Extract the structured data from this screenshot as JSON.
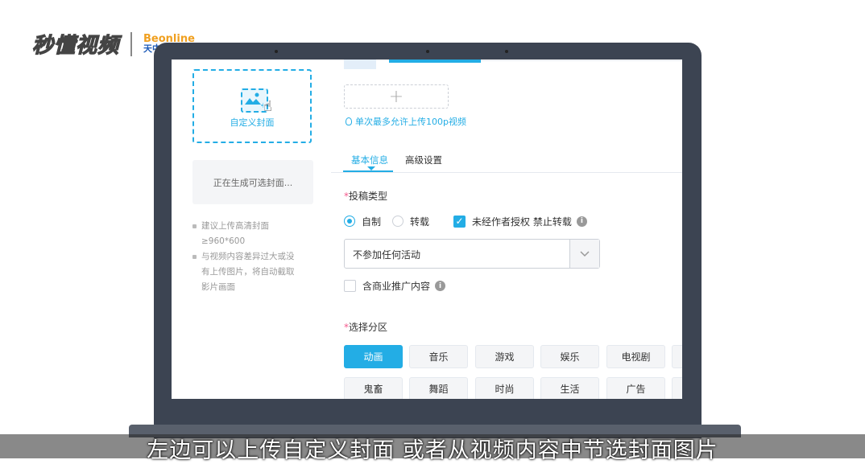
{
  "watermark": {
    "logo": "秒懂视频",
    "partner_top": "Beonline",
    "partner_bottom": "天中天学前班"
  },
  "cover": {
    "custom_label": "自定义封面",
    "generating_label": "正在生成可选封面...",
    "tips": [
      [
        "建议上传高清封面",
        "≥960*600"
      ],
      [
        "与视频内容差异过大或没",
        "有上传图片，将自动截取",
        "影片画面"
      ]
    ]
  },
  "upload": {
    "add_symbol": "+",
    "hint": "单次最多允许上传100p视频"
  },
  "tabs": [
    {
      "label": "基本信息",
      "active": true
    },
    {
      "label": "高级设置",
      "active": false
    }
  ],
  "form": {
    "type_label": "投稿类型",
    "required_mark": "*",
    "radio_original": "自制",
    "radio_repost": "转载",
    "no_repost_label": "未经作者授权 禁止转载",
    "activity_select": "不参加任何活动",
    "commercial_label": "含商业推广内容",
    "zone_label": "选择分区",
    "zones_row1": [
      "动画",
      "音乐",
      "游戏",
      "娱乐",
      "电视剧"
    ],
    "zones_row2": [
      "鬼畜",
      "舞蹈",
      "时尚",
      "生活",
      "广告"
    ],
    "active_zone": "动画"
  },
  "subtitle": "左边可以上传自定义封面 或者从视频内容中节选封面图片",
  "colors": {
    "accent": "#23ade5",
    "required": "#f45a8d",
    "laptop_frame": "#3c4452"
  },
  "icons": [
    "image-upload-icon",
    "hand-cursor-icon",
    "bulb-icon",
    "info-icon",
    "chevron-down-icon",
    "check-icon"
  ]
}
